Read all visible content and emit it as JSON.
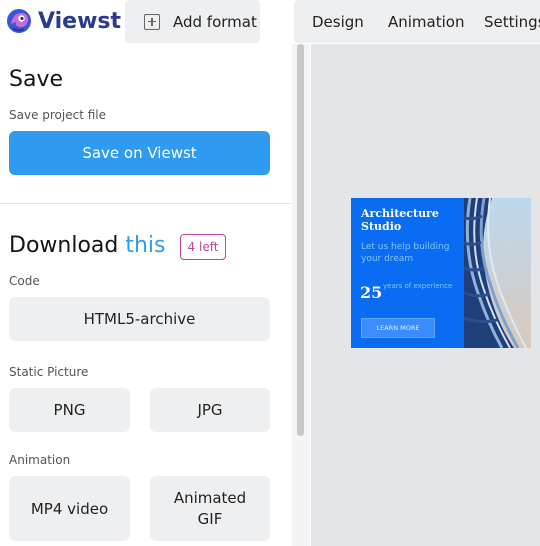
{
  "app": {
    "brand": "Viewst"
  },
  "topbar": {
    "add_format_label": "Add format",
    "tabs": [
      {
        "label": "Design"
      },
      {
        "label": "Animation"
      },
      {
        "label": "Settings"
      }
    ]
  },
  "save_section": {
    "title": "Save",
    "subtitle": "Save project file",
    "button_label": "Save on Viewst"
  },
  "download_section": {
    "title_prefix": "Download",
    "title_accent": "this",
    "badge": "4 left",
    "groups": [
      {
        "label": "Code",
        "buttons": [
          {
            "label": "HTML5-archive"
          }
        ]
      },
      {
        "label": "Static Picture",
        "buttons": [
          {
            "label": "PNG"
          },
          {
            "label": "JPG"
          }
        ]
      },
      {
        "label": "Animation",
        "buttons": [
          {
            "label": "MP4 video"
          },
          {
            "label": "Animated GIF"
          }
        ]
      }
    ]
  },
  "preview": {
    "ad_title": "Architecture Studio",
    "ad_tagline": "Let us help building your dream",
    "ad_number": "25",
    "ad_years_text": "years of experience",
    "ad_button": "LEARN MORE"
  },
  "colors": {
    "accent": "#2e9bf0",
    "badge": "#c0449a",
    "brand": "#2a3a8c",
    "ad_background": "#0a6cf2"
  }
}
